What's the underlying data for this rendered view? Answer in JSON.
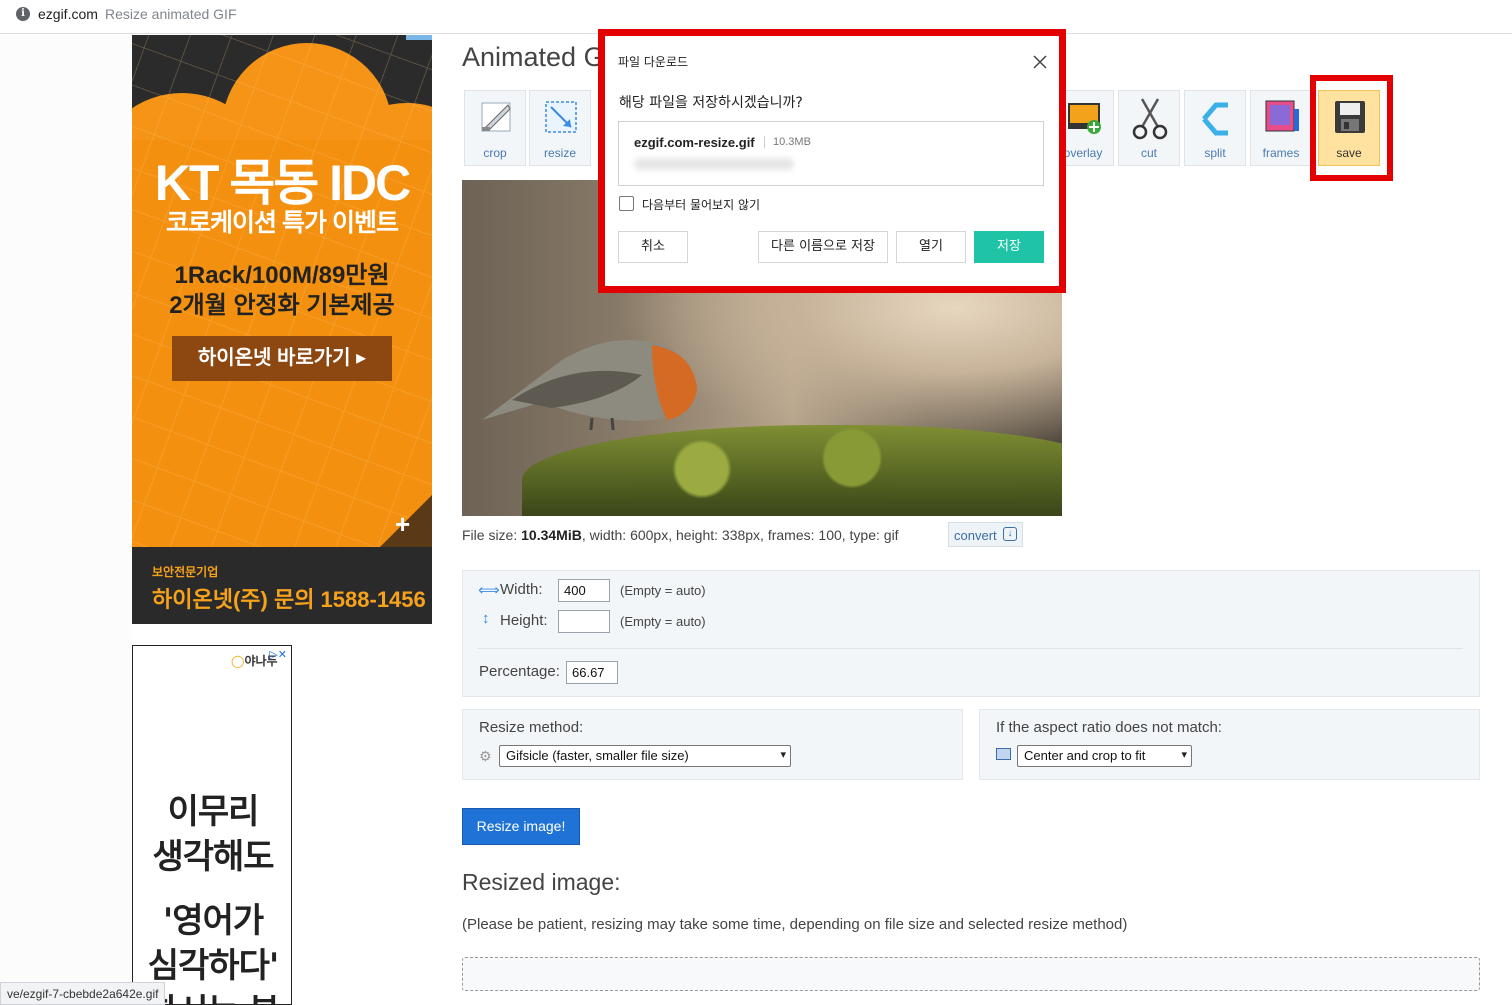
{
  "browser": {
    "domain": "ezgif.com",
    "page_title": "Resize animated GIF"
  },
  "status_url": "ve/ezgif-7-cbebde2a642e.gif",
  "ads": {
    "kt": {
      "line1": "KT 목동 IDC",
      "line2": "코로케이션 특가 이벤트",
      "line3": "1Rack/100M/89만원",
      "line4": "2개월 안정화 기본제공",
      "cta": "하이온넷 바로가기 ▸",
      "plus": "+",
      "footer_small": "보안전문기업",
      "footer_big": "하이온넷(주) 문의 1588-1456"
    },
    "english": {
      "logo_text": "야나두",
      "line1": "이무리",
      "line2": "생각해도",
      "line3": "'영어가",
      "line4": "심각하다'",
      "line5": "하시는 분"
    }
  },
  "main": {
    "title": "Animated GIF resizer",
    "toolbar": [
      {
        "label": "crop",
        "icon": "crop-icon"
      },
      {
        "label": "resize",
        "icon": "resize-icon"
      },
      {
        "label": "overlay",
        "icon": "overlay-icon"
      },
      {
        "label": "cut",
        "icon": "scissors-icon"
      },
      {
        "label": "split",
        "icon": "split-icon"
      },
      {
        "label": "frames",
        "icon": "frames-icon"
      },
      {
        "label": "save",
        "icon": "floppy-disk-icon"
      }
    ],
    "fileinfo": {
      "prefix": "File size: ",
      "size": "10.34MiB",
      "rest": ", width: 600px, height: 338px, frames: 100, type: gif"
    },
    "convert_label": "convert",
    "dims": {
      "width_label": "Width:",
      "width_value": "400",
      "height_label": "Height:",
      "height_value": "",
      "auto_hint": "(Empty = auto)",
      "percentage_label": "Percentage:",
      "percentage_value": "66.67"
    },
    "method": {
      "label": "Resize method:",
      "selected": "Gifsicle (faster, smaller file size)"
    },
    "aspect": {
      "label": "If the aspect ratio does not match:",
      "selected": "Center and crop to fit"
    },
    "resize_button": "Resize image!",
    "resized_title": "Resized image:",
    "patience_note": "(Please be patient, resizing may take some time, depending on file size and selected resize method)"
  },
  "dialog": {
    "title": "파일 다운로드",
    "question": "해당 파일을 저장하시겠습니까?",
    "filename": "ezgif.com-resize.gif",
    "filesize": "10.3MB",
    "checkbox_label": "다음부터 물어보지 않기",
    "cancel": "취소",
    "save_as": "다른 이름으로 저장",
    "open": "열기",
    "save": "저장"
  },
  "colors": {
    "highlight": "#e30000",
    "primary": "#1f73d6",
    "dialog_ok": "#1fc4a6",
    "ad_orange": "#f28e12"
  }
}
